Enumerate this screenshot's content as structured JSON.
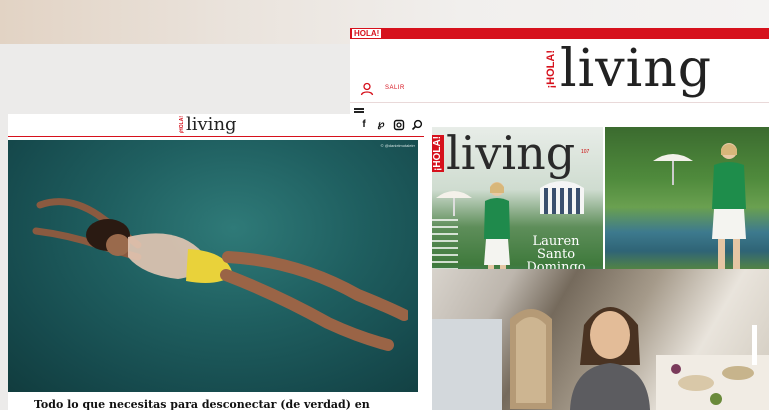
{
  "right_site": {
    "hola_tag": "HOLA!",
    "brand_hola": "¡HOLA!",
    "brand_word": "living",
    "logout_label": "SALIR",
    "cover": {
      "hola": "¡HOLA!",
      "word": "living",
      "issue": "107",
      "name_line1": "Lauren",
      "name_line2": "Santo",
      "name_line3": "Domingo"
    }
  },
  "left_site": {
    "brand_hola": "¡HOLA!",
    "brand_word": "living",
    "photo_credit": "© @danielmotaleirr",
    "social": {
      "facebook": "f",
      "pinterest": "℘"
    },
    "headline": "Todo lo que necesitas para desconectar (de verdad) en"
  },
  "colors": {
    "brand_red": "#d6111c",
    "pool_teal": "#1f5f60"
  }
}
